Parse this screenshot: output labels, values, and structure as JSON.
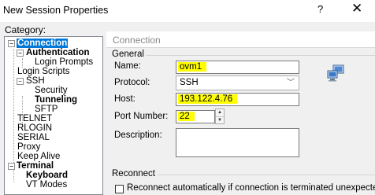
{
  "window": {
    "title": "New Session Properties",
    "help_label": "?",
    "close_label": "✕"
  },
  "category": {
    "label": "Category:",
    "items": [
      {
        "label": "Connection",
        "level": 0,
        "bold": true,
        "selected": true,
        "expander": "−"
      },
      {
        "label": "Authentication",
        "level": 1,
        "bold": true,
        "expander": "−"
      },
      {
        "label": "Login Prompts",
        "level": 2
      },
      {
        "label": "Login Scripts",
        "level": 1
      },
      {
        "label": "SSH",
        "level": 1,
        "expander": "−"
      },
      {
        "label": "Security",
        "level": 2
      },
      {
        "label": "Tunneling",
        "level": 2,
        "bold": true
      },
      {
        "label": "SFTP",
        "level": 2
      },
      {
        "label": "TELNET",
        "level": 1
      },
      {
        "label": "RLOGIN",
        "level": 1
      },
      {
        "label": "SERIAL",
        "level": 1
      },
      {
        "label": "Proxy",
        "level": 1
      },
      {
        "label": "Keep Alive",
        "level": 1
      },
      {
        "label": "Terminal",
        "level": 0,
        "bold": true,
        "expander": "−"
      },
      {
        "label": "Keyboard",
        "level": 1,
        "bold": true
      },
      {
        "label": "VT Modes",
        "level": 1
      }
    ]
  },
  "panel": {
    "header": "Connection",
    "general_label": "General",
    "name_label": "Name:",
    "name_value": "ovm1",
    "protocol_label": "Protocol:",
    "protocol_value": "SSH",
    "host_label": "Host:",
    "host_value": "193.122.4.76",
    "port_label": "Port Number:",
    "port_value": "22",
    "description_label": "Description:",
    "description_value": "",
    "reconnect_label": "Reconnect",
    "reconnect_checkbox_label": "Reconnect automatically if connection is terminated unexpectedly",
    "reconnect_checked": false
  },
  "colors": {
    "highlight": "#ffff00",
    "selection": "#0078d7"
  },
  "icons": {
    "session": "computer-network-icon",
    "spinner_up": "chevron-up-icon",
    "spinner_down": "chevron-down-icon"
  }
}
